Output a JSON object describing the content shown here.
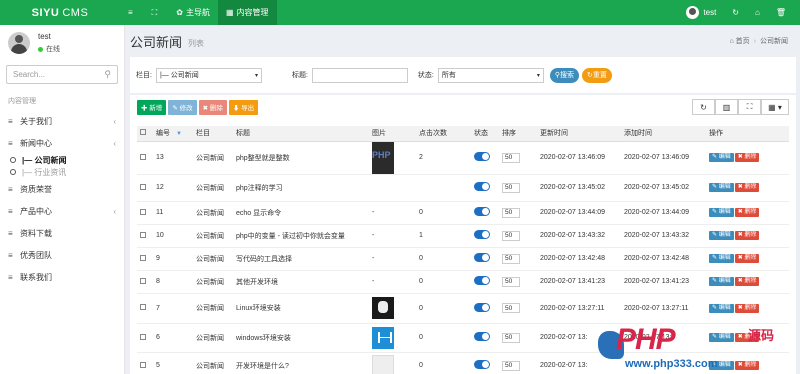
{
  "brand": {
    "name_bold": "SIYU",
    "name_thin": "CMS"
  },
  "topnav": {
    "items": [
      {
        "icon": "≡",
        "label": ""
      },
      {
        "icon": "⛶",
        "label": ""
      },
      {
        "icon": "✿",
        "label": "主导航"
      },
      {
        "icon": "▦",
        "label": "内容管理"
      }
    ]
  },
  "topright": {
    "user": "test",
    "refresh_icon": "↻",
    "home_icon": "⌂",
    "trash_icon": "🗑"
  },
  "user_panel": {
    "name": "test",
    "status": "在线"
  },
  "search": {
    "placeholder": "Search..."
  },
  "menu": {
    "heading": "内容管理",
    "items": [
      {
        "label": "关于我们",
        "chev": "‹"
      },
      {
        "label": "新闻中心",
        "chev": "‹"
      },
      {
        "label": "资质荣誉",
        "chev": ""
      },
      {
        "label": "产品中心",
        "chev": "‹"
      },
      {
        "label": "资料下载",
        "chev": ""
      },
      {
        "label": "优秀团队",
        "chev": ""
      },
      {
        "label": "联系我们",
        "chev": ""
      }
    ],
    "subitems": [
      {
        "label": "|— 公司新闻"
      },
      {
        "label": "|— 行业资讯"
      }
    ]
  },
  "page": {
    "title": "公司新闻",
    "subtitle": "列表",
    "crumb_home": "首页",
    "crumb_current": "公司新闻"
  },
  "filter": {
    "column_label": "栏目:",
    "column_value": "|— 公司新闻",
    "title_label": "标题:",
    "title_value": "",
    "status_label": "状态:",
    "status_value": "所有",
    "search_btn": "搜索",
    "reset_btn": "重置"
  },
  "toolbar": {
    "add": "✚ 新增",
    "edit": "✎ 修改",
    "delete": "✖ 删除",
    "export": "⬇ 导出"
  },
  "tools": [
    "↻",
    "▥",
    "⛶",
    "▦ ▾"
  ],
  "table": {
    "headers": [
      "编号",
      "栏目",
      "标题",
      "图片",
      "点击次数",
      "状态",
      "排序",
      "更新时间",
      "添加时间",
      "操作"
    ],
    "edit_label": "✎ 编辑",
    "delete_label": "✖ 删除",
    "rows": [
      {
        "id": "13",
        "column": "公司新闻",
        "title": "php整型就是整数",
        "image": "php",
        "clicks": "2",
        "sort": "50",
        "updated": "2020-02-07 13:46:09",
        "added": "2020-02-07 13:46:09"
      },
      {
        "id": "12",
        "column": "公司新闻",
        "title": "php注释的学习",
        "image": "none",
        "clicks": "",
        "sort": "50",
        "updated": "2020-02-07 13:45:02",
        "added": "2020-02-07 13:45:02"
      },
      {
        "id": "11",
        "column": "公司新闻",
        "title": "echo 显示命令",
        "image": "-",
        "clicks": "0",
        "sort": "50",
        "updated": "2020-02-07 13:44:09",
        "added": "2020-02-07 13:44:09"
      },
      {
        "id": "10",
        "column": "公司新闻",
        "title": "php中的变量 - 读过初中你就会变量",
        "image": "-",
        "clicks": "1",
        "sort": "50",
        "updated": "2020-02-07 13:43:32",
        "added": "2020-02-07 13:43:32"
      },
      {
        "id": "9",
        "column": "公司新闻",
        "title": "写代码的工具选择",
        "image": "-",
        "clicks": "0",
        "sort": "50",
        "updated": "2020-02-07 13:42:48",
        "added": "2020-02-07 13:42:48"
      },
      {
        "id": "8",
        "column": "公司新闻",
        "title": "其他开发环境",
        "image": "-",
        "clicks": "0",
        "sort": "50",
        "updated": "2020-02-07 13:41:23",
        "added": "2020-02-07 13:41:23"
      },
      {
        "id": "7",
        "column": "公司新闻",
        "title": "Linux环境安装",
        "image": "linux",
        "clicks": "0",
        "sort": "50",
        "updated": "2020-02-07 13:27:11",
        "added": "2020-02-07 13:27:11"
      },
      {
        "id": "6",
        "column": "公司新闻",
        "title": "windows环境安装",
        "image": "win",
        "clicks": "0",
        "sort": "50",
        "updated": "2020-02-07 13:",
        "added": "2020-02-07 13:"
      },
      {
        "id": "5",
        "column": "公司新闻",
        "title": "开发环境是什么?",
        "image": "paper",
        "clicks": "0",
        "sort": "50",
        "updated": "2020-02-07 13:",
        "added": ""
      }
    ]
  },
  "watermark": {
    "big": "PHP",
    "cn": "源码",
    "url": "www.php333.com"
  }
}
